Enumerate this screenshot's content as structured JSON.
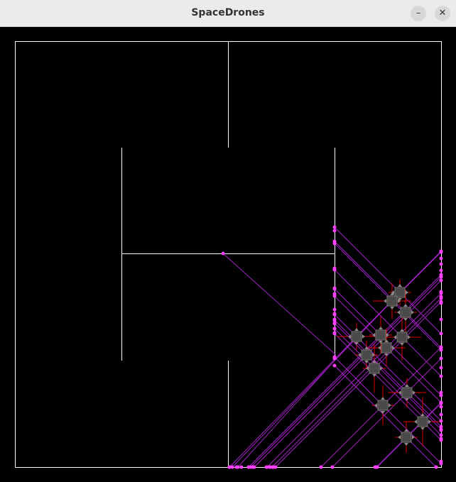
{
  "window": {
    "title": "SpaceDrones",
    "minimize_icon": "minimize-icon",
    "close_icon": "close-icon",
    "minimize_glyph": "–",
    "close_glyph": "✕"
  },
  "colors": {
    "background": "#000000",
    "walls": "#ffffff",
    "rays": "#a020c0",
    "ray_hits": "#ff40ff",
    "drone_body": "#4a4a4a",
    "drone_thrusters": "#888888",
    "thrust": "#e00000"
  }
}
